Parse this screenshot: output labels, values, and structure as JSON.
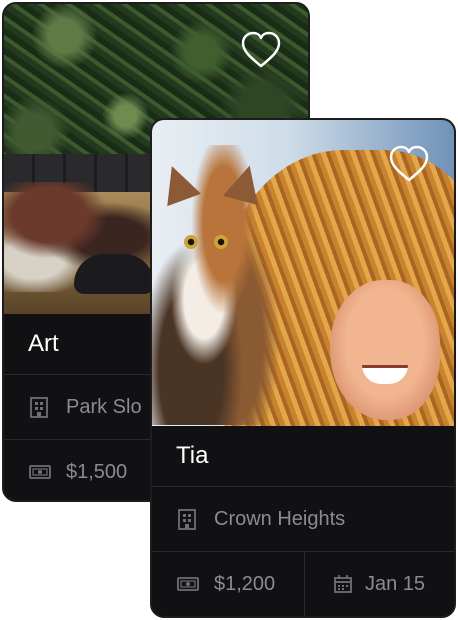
{
  "cards": [
    {
      "name": "Art",
      "neighborhood": "Park Slo",
      "price": "$1,500"
    },
    {
      "name": "Tia",
      "neighborhood": "Crown Heights",
      "price": "$1,200",
      "move_in": "Jan 15"
    }
  ],
  "colors": {
    "card_bg": "#111114",
    "primary_text": "#ffffff",
    "secondary_text": "#8b8b90",
    "divider": "#2a2a2d"
  },
  "icons": [
    "heart-outline-icon",
    "building-icon",
    "money-icon",
    "calendar-icon"
  ]
}
